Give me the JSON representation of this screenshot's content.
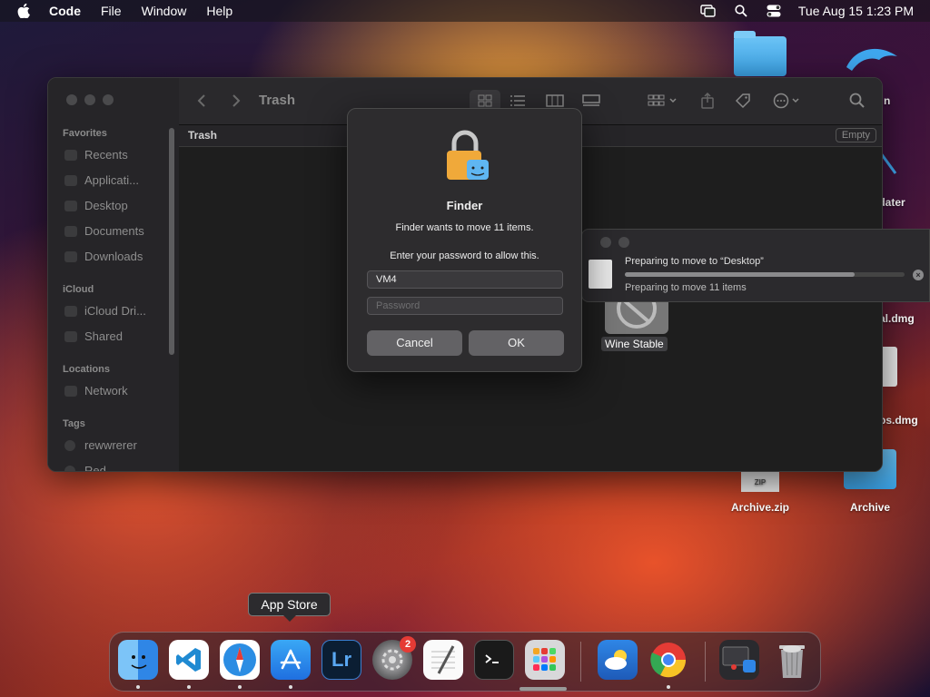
{
  "menubar": {
    "app_name": "Code",
    "items": [
      "File",
      "Window",
      "Help"
    ],
    "datetime": "Tue Aug 15  1:23 PM"
  },
  "desktop_icons": {
    "partial_n": "n",
    "updater": "odater",
    "dmg1": "al.dmg",
    "dmg2": "ps.dmg",
    "archive_zip": "Archive.zip",
    "archive": "Archive",
    "zip_tag": "ZIP"
  },
  "finder": {
    "toolbar_title": "Trash",
    "path_title": "Trash",
    "empty_button": "Empty",
    "sidebar": {
      "favorites_label": "Favorites",
      "favorites": [
        "Recents",
        "Applicati...",
        "Desktop",
        "Documents",
        "Downloads"
      ],
      "icloud_label": "iCloud",
      "icloud": [
        "iCloud Dri...",
        "Shared"
      ],
      "locations_label": "Locations",
      "locations": [
        "Network"
      ],
      "tags_label": "Tags",
      "tags": [
        "rewwrerer",
        "Red"
      ]
    }
  },
  "auth_dialog": {
    "title": "Finder",
    "message": "Finder wants to move 11 items.",
    "prompt": "Enter your password to allow this.",
    "username_value": "VM4",
    "password_placeholder": "Password",
    "cancel_label": "Cancel",
    "ok_label": "OK"
  },
  "progress": {
    "title": "Preparing to move to “Desktop”",
    "status": "Preparing to move 11 items",
    "fraction": 0.82
  },
  "wine_label": "Wine Stable",
  "dock": {
    "tooltip": "App Store",
    "settings_badge": "2",
    "lr_label": "Lr"
  }
}
